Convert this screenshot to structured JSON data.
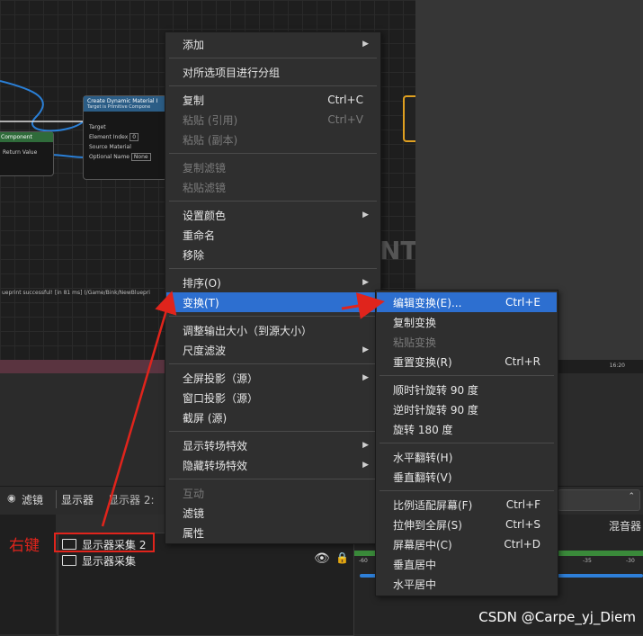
{
  "preview": {
    "node_title": "Create Dynamic Material I",
    "node_subtitle": "Target is Primitive Compone",
    "node_pins": [
      "Target",
      "Element Index",
      "Source Material",
      "Optional Name"
    ],
    "node_index_value": "0",
    "node_name_value": "None",
    "left_node_label": "Component",
    "left_node_pin": "Return Value",
    "watermark_fragment": "NT",
    "log_text": "ueprint successful! [in 81 ms] (/Game/Bink/NewBluepri",
    "clock": "16:20"
  },
  "obs": {
    "filters_label": "滤镜",
    "display_label": "显示器",
    "display_dropdown": "显示器 2:",
    "mixer_title": "混音器",
    "mixer_ticks": [
      "-60",
      "-35",
      "-30"
    ],
    "sources": [
      {
        "name": "显示器采集 2",
        "selected": true
      },
      {
        "name": "显示器采集",
        "selected": false
      }
    ],
    "annotation": "右键"
  },
  "menu": {
    "items": [
      {
        "label": "添加",
        "shortcut": "",
        "submenu": true,
        "disabled": false
      },
      {
        "sep": true
      },
      {
        "label": "对所选项目进行分组",
        "shortcut": "",
        "submenu": false,
        "disabled": false
      },
      {
        "sep": true
      },
      {
        "label": "复制",
        "shortcut": "Ctrl+C",
        "submenu": false,
        "disabled": false
      },
      {
        "label": "粘贴 (引用)",
        "shortcut": "Ctrl+V",
        "submenu": false,
        "disabled": true
      },
      {
        "label": "粘贴 (副本)",
        "shortcut": "",
        "submenu": false,
        "disabled": true
      },
      {
        "sep": true
      },
      {
        "label": "复制滤镜",
        "shortcut": "",
        "submenu": false,
        "disabled": true
      },
      {
        "label": "粘贴滤镜",
        "shortcut": "",
        "submenu": false,
        "disabled": true
      },
      {
        "sep": true
      },
      {
        "label": "设置颜色",
        "shortcut": "",
        "submenu": true,
        "disabled": false
      },
      {
        "label": "重命名",
        "shortcut": "",
        "submenu": false,
        "disabled": false
      },
      {
        "label": "移除",
        "shortcut": "",
        "submenu": false,
        "disabled": false
      },
      {
        "sep": true
      },
      {
        "label": "排序(O)",
        "shortcut": "",
        "submenu": true,
        "disabled": false
      },
      {
        "label": "变换(T)",
        "shortcut": "",
        "submenu": true,
        "disabled": false,
        "selected": true
      },
      {
        "sep": true
      },
      {
        "label": "调整输出大小（到源大小）",
        "shortcut": "",
        "submenu": false,
        "disabled": false
      },
      {
        "label": "尺度滤波",
        "shortcut": "",
        "submenu": true,
        "disabled": false
      },
      {
        "sep": true
      },
      {
        "label": "全屏投影（源）",
        "shortcut": "",
        "submenu": true,
        "disabled": false
      },
      {
        "label": "窗口投影（源）",
        "shortcut": "",
        "submenu": false,
        "disabled": false
      },
      {
        "label": "截屏 (源)",
        "shortcut": "",
        "submenu": false,
        "disabled": false
      },
      {
        "sep": true
      },
      {
        "label": "显示转场特效",
        "shortcut": "",
        "submenu": true,
        "disabled": false
      },
      {
        "label": "隐藏转场特效",
        "shortcut": "",
        "submenu": true,
        "disabled": false
      },
      {
        "sep": true
      },
      {
        "label": "互动",
        "shortcut": "",
        "submenu": false,
        "disabled": true
      },
      {
        "label": "滤镜",
        "shortcut": "",
        "submenu": false,
        "disabled": false
      },
      {
        "label": "属性",
        "shortcut": "",
        "submenu": false,
        "disabled": false
      }
    ]
  },
  "submenu": {
    "items": [
      {
        "label": "编辑变换(E)...",
        "shortcut": "Ctrl+E",
        "disabled": false,
        "selected": true
      },
      {
        "label": "复制变换",
        "shortcut": "",
        "disabled": false
      },
      {
        "label": "粘贴变换",
        "shortcut": "",
        "disabled": true
      },
      {
        "label": "重置变换(R)",
        "shortcut": "Ctrl+R",
        "disabled": false
      },
      {
        "sep": true
      },
      {
        "label": "顺时针旋转 90 度",
        "shortcut": "",
        "disabled": false
      },
      {
        "label": "逆时针旋转 90 度",
        "shortcut": "",
        "disabled": false
      },
      {
        "label": "旋转 180 度",
        "shortcut": "",
        "disabled": false
      },
      {
        "sep": true
      },
      {
        "label": "水平翻转(H)",
        "shortcut": "",
        "disabled": false
      },
      {
        "label": "垂直翻转(V)",
        "shortcut": "",
        "disabled": false
      },
      {
        "sep": true
      },
      {
        "label": "比例适配屏幕(F)",
        "shortcut": "Ctrl+F",
        "disabled": false
      },
      {
        "label": "拉伸到全屏(S)",
        "shortcut": "Ctrl+S",
        "disabled": false
      },
      {
        "label": "屏幕居中(C)",
        "shortcut": "Ctrl+D",
        "disabled": false
      },
      {
        "label": "垂直居中",
        "shortcut": "",
        "disabled": false
      },
      {
        "label": "水平居中",
        "shortcut": "",
        "disabled": false
      }
    ]
  },
  "watermark": "CSDN @Carpe_yj_Diem",
  "colors": {
    "highlight": "#2d6fd0",
    "annotation": "#e0241c"
  }
}
